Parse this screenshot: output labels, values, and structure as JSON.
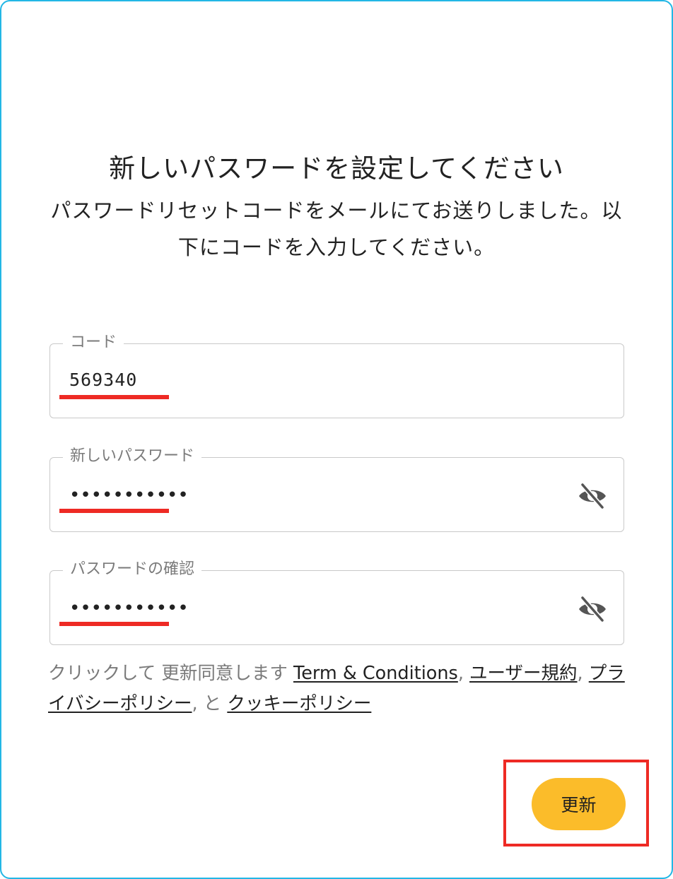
{
  "header": {
    "title": "新しいパスワードを設定してください",
    "subtitle": "パスワードリセットコードをメールにてお送りしました。以下にコードを入力してください。"
  },
  "form": {
    "code": {
      "label": "コード",
      "value": "569340"
    },
    "new_password": {
      "label": "新しいパスワード",
      "value": "•••••••••••",
      "toggle_icon": "eye-off-icon"
    },
    "confirm_password": {
      "label": "パスワードの確認",
      "value": "•••••••••••",
      "toggle_icon": "eye-off-icon"
    }
  },
  "terms": {
    "prefix": "クリックして 更新同意します ",
    "terms_link": "Term & Conditions",
    "comma1": ", ",
    "user_agreement_link": "ユーザー規約",
    "comma2": ", ",
    "privacy_link": "プライバシーポリシー",
    "and": ", と ",
    "cookie_link": "クッキーポリシー"
  },
  "actions": {
    "update_label": "更新"
  },
  "colors": {
    "frame_border": "#23b7e5",
    "button_bg": "#fbbc2a",
    "annotation_red": "#ee2a24"
  }
}
